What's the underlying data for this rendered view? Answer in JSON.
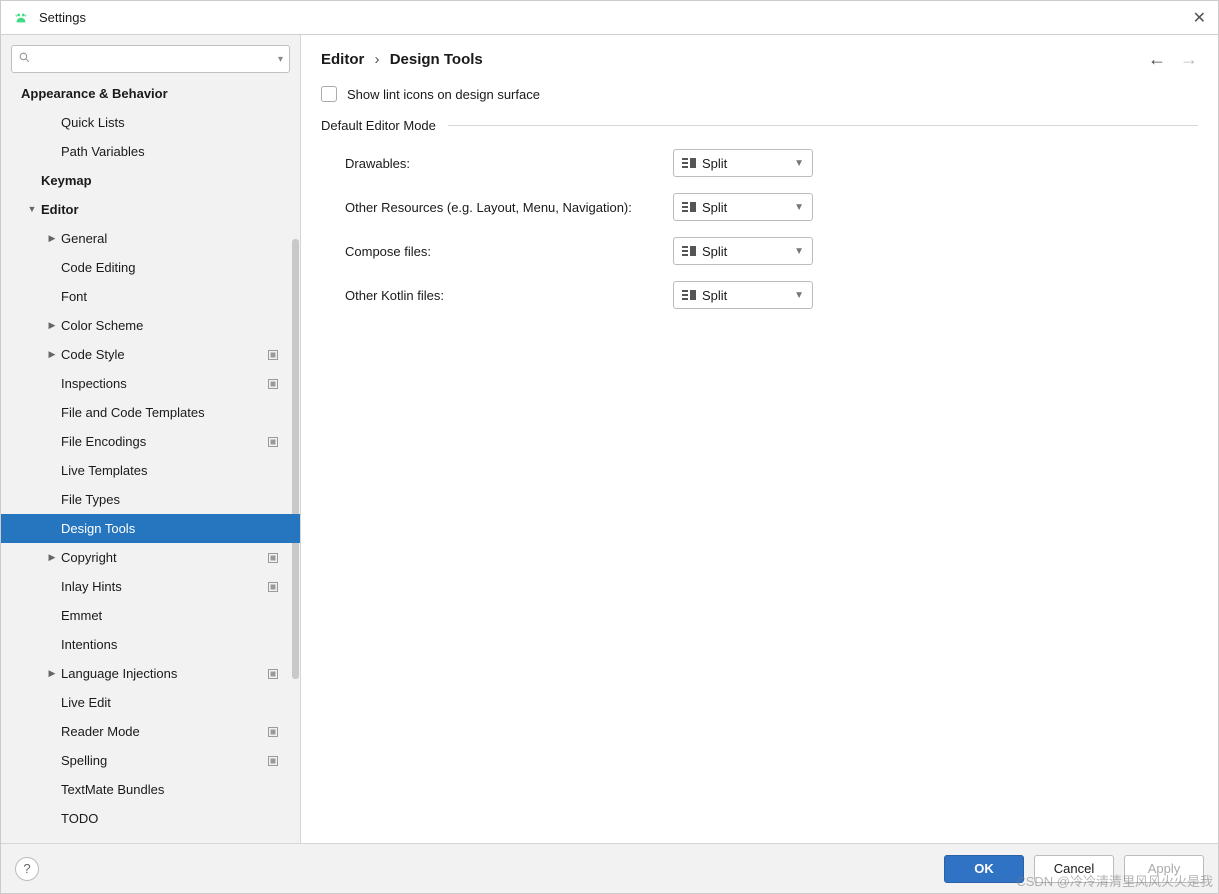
{
  "window": {
    "title": "Settings"
  },
  "breadcrumb": {
    "parent": "Editor",
    "current": "Design Tools"
  },
  "nav": {
    "back_enabled": true,
    "forward_enabled": false
  },
  "search": {
    "placeholder": ""
  },
  "sidebar": {
    "items": [
      {
        "label": "Appearance & Behavior",
        "indent": 0,
        "bold": true,
        "arrow": "",
        "badge": false,
        "selected": false
      },
      {
        "label": "Quick Lists",
        "indent": 2,
        "bold": false,
        "arrow": "",
        "badge": false,
        "selected": false
      },
      {
        "label": "Path Variables",
        "indent": 2,
        "bold": false,
        "arrow": "",
        "badge": false,
        "selected": false
      },
      {
        "label": "Keymap",
        "indent": 1,
        "bold": true,
        "arrow": "",
        "badge": false,
        "selected": false
      },
      {
        "label": "Editor",
        "indent": 1,
        "bold": true,
        "arrow": "down",
        "badge": false,
        "selected": false
      },
      {
        "label": "General",
        "indent": 2,
        "bold": false,
        "arrow": "right",
        "badge": false,
        "selected": false
      },
      {
        "label": "Code Editing",
        "indent": 2,
        "bold": false,
        "arrow": "",
        "badge": false,
        "selected": false
      },
      {
        "label": "Font",
        "indent": 2,
        "bold": false,
        "arrow": "",
        "badge": false,
        "selected": false
      },
      {
        "label": "Color Scheme",
        "indent": 2,
        "bold": false,
        "arrow": "right",
        "badge": false,
        "selected": false
      },
      {
        "label": "Code Style",
        "indent": 2,
        "bold": false,
        "arrow": "right",
        "badge": true,
        "selected": false
      },
      {
        "label": "Inspections",
        "indent": 2,
        "bold": false,
        "arrow": "",
        "badge": true,
        "selected": false
      },
      {
        "label": "File and Code Templates",
        "indent": 2,
        "bold": false,
        "arrow": "",
        "badge": false,
        "selected": false
      },
      {
        "label": "File Encodings",
        "indent": 2,
        "bold": false,
        "arrow": "",
        "badge": true,
        "selected": false
      },
      {
        "label": "Live Templates",
        "indent": 2,
        "bold": false,
        "arrow": "",
        "badge": false,
        "selected": false
      },
      {
        "label": "File Types",
        "indent": 2,
        "bold": false,
        "arrow": "",
        "badge": false,
        "selected": false
      },
      {
        "label": "Design Tools",
        "indent": 2,
        "bold": false,
        "arrow": "",
        "badge": false,
        "selected": true
      },
      {
        "label": "Copyright",
        "indent": 2,
        "bold": false,
        "arrow": "right",
        "badge": true,
        "selected": false
      },
      {
        "label": "Inlay Hints",
        "indent": 2,
        "bold": false,
        "arrow": "",
        "badge": true,
        "selected": false
      },
      {
        "label": "Emmet",
        "indent": 2,
        "bold": false,
        "arrow": "",
        "badge": false,
        "selected": false
      },
      {
        "label": "Intentions",
        "indent": 2,
        "bold": false,
        "arrow": "",
        "badge": false,
        "selected": false
      },
      {
        "label": "Language Injections",
        "indent": 2,
        "bold": false,
        "arrow": "right",
        "badge": true,
        "selected": false
      },
      {
        "label": "Live Edit",
        "indent": 2,
        "bold": false,
        "arrow": "",
        "badge": false,
        "selected": false
      },
      {
        "label": "Reader Mode",
        "indent": 2,
        "bold": false,
        "arrow": "",
        "badge": true,
        "selected": false
      },
      {
        "label": "Spelling",
        "indent": 2,
        "bold": false,
        "arrow": "",
        "badge": true,
        "selected": false
      },
      {
        "label": "TextMate Bundles",
        "indent": 2,
        "bold": false,
        "arrow": "",
        "badge": false,
        "selected": false
      },
      {
        "label": "TODO",
        "indent": 2,
        "bold": false,
        "arrow": "",
        "badge": false,
        "selected": false
      }
    ]
  },
  "panel": {
    "show_lint_label": "Show lint icons on design surface",
    "show_lint_checked": false,
    "section_title": "Default Editor Mode",
    "rows": [
      {
        "label": "Drawables:",
        "value": "Split"
      },
      {
        "label": "Other Resources (e.g. Layout, Menu, Navigation):",
        "value": "Split"
      },
      {
        "label": "Compose files:",
        "value": "Split"
      },
      {
        "label": "Other Kotlin files:",
        "value": "Split"
      }
    ]
  },
  "footer": {
    "ok": "OK",
    "cancel": "Cancel",
    "apply": "Apply",
    "apply_enabled": false
  },
  "watermark": "CSDN @冷冷清清里风风火火是我"
}
